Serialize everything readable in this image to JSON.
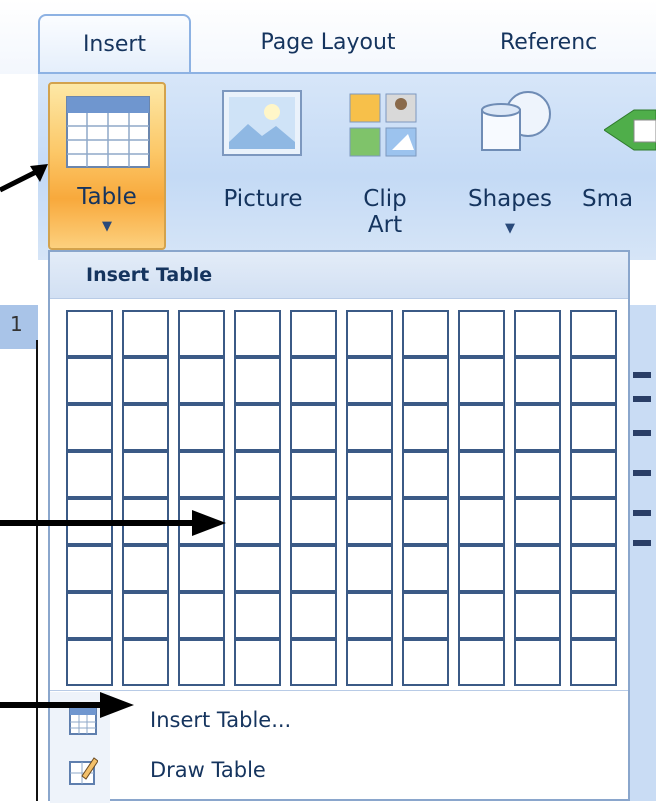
{
  "ribbon": {
    "tabs": [
      {
        "label": "Insert",
        "active": true
      },
      {
        "label": "Page Layout",
        "active": false
      },
      {
        "label": "Referenc",
        "active": false
      }
    ],
    "buttons": {
      "table": {
        "label": "Table",
        "icon": "table-icon"
      },
      "picture": {
        "label": "Picture",
        "icon": "picture-icon"
      },
      "clip_art": {
        "label_line1": "Clip",
        "label_line2": "Art",
        "icon": "clip-art-icon"
      },
      "shapes": {
        "label": "Shapes",
        "icon": "shapes-icon"
      },
      "smartart": {
        "label": "Sma",
        "icon": "smartart-icon"
      }
    },
    "ruler_number": "1"
  },
  "dropdown": {
    "title": "Insert Table",
    "grid": {
      "columns": 10,
      "rows": 8
    },
    "menu": [
      {
        "label": "Insert Table...",
        "icon": "insert-table-icon"
      },
      {
        "label": "Draw Table",
        "icon": "draw-table-icon"
      }
    ]
  },
  "colors": {
    "ribbon_bg": "#c4daf5",
    "tab_text": "#15345e",
    "table_button": "#f8a93c",
    "grid_border": "#3b5a86",
    "annotation_arrow": "#000000"
  }
}
